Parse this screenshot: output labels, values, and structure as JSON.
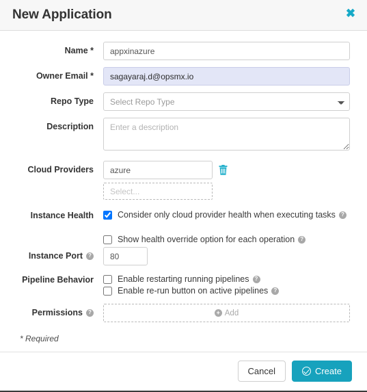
{
  "header": {
    "title": "New Application",
    "close_icon": "close-x-icon"
  },
  "form": {
    "name": {
      "label": "Name *",
      "value": "appxinazure",
      "placeholder": ""
    },
    "owner_email": {
      "label": "Owner Email *",
      "value": "sagayaraj.d@opsmx.io",
      "placeholder": ""
    },
    "repo_type": {
      "label": "Repo Type",
      "selected": "Select Repo Type",
      "options": [
        "Select Repo Type"
      ]
    },
    "description": {
      "label": "Description",
      "value": "",
      "placeholder": "Enter a description"
    },
    "cloud_providers": {
      "label": "Cloud Providers",
      "value": "azure",
      "delete_icon": "trash-icon",
      "add_placeholder": "Select..."
    },
    "instance_health": {
      "label": "Instance Health",
      "option1": {
        "text": "Consider only cloud provider health when executing tasks",
        "checked": true,
        "help": "?"
      },
      "option2": {
        "text": "Show health override option for each operation",
        "checked": false,
        "help": "?"
      }
    },
    "instance_port": {
      "label": "Instance Port",
      "value": "80",
      "help": "?"
    },
    "pipeline_behavior": {
      "label": "Pipeline Behavior",
      "option1": {
        "text": "Enable restarting running pipelines",
        "checked": false,
        "help": "?"
      },
      "option2": {
        "text": "Enable re-run button on active pipelines",
        "checked": false,
        "help": "?"
      }
    },
    "permissions": {
      "label": "Permissions",
      "help": "?",
      "add_label": "Add",
      "add_icon": "circle-plus-icon"
    },
    "required_note": "* Required"
  },
  "footer": {
    "cancel_label": "Cancel",
    "create_label": "Create",
    "create_icon": "check-circle-icon"
  },
  "colors": {
    "accent": "#17a2bd",
    "close": "#16a9c7",
    "trash": "#23b0cc",
    "autofill_bg": "#e3e6f7",
    "header_bg": "#f7f7f7"
  }
}
